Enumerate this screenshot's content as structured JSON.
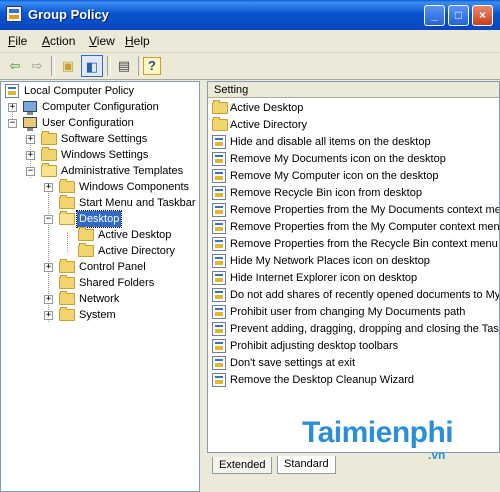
{
  "window": {
    "title": "Group Policy",
    "buttons": {
      "minimize": "_",
      "maximize": "□",
      "close": "×"
    }
  },
  "menu": [
    {
      "mnemonic": "F",
      "rest": "ile"
    },
    {
      "mnemonic": "A",
      "rest": "ction"
    },
    {
      "mnemonic": "V",
      "rest": "iew"
    },
    {
      "mnemonic": "H",
      "rest": "elp"
    }
  ],
  "toolbar": {
    "back": "⇦",
    "forward": "⇨",
    "up_folder": "▣",
    "show_hide_tree": "◧",
    "export_list": "▤",
    "help": "?"
  },
  "tree": {
    "root": "Local Computer Policy",
    "computer_configuration": "Computer Configuration",
    "user_configuration": "User Configuration",
    "software_settings": "Software Settings",
    "windows_settings": "Windows Settings",
    "administrative_templates": "Administrative Templates",
    "windows_components": "Windows Components",
    "start_menu_and_taskbar": "Start Menu and Taskbar",
    "desktop": "Desktop",
    "active_desktop": "Active Desktop",
    "active_directory": "Active Directory",
    "control_panel": "Control Panel",
    "shared_folders": "Shared Folders",
    "network": "Network",
    "system": "System",
    "expand_plus": "+",
    "collapse_minus": "−"
  },
  "list": {
    "column_header": "Setting",
    "folders": [
      "Active Desktop",
      "Active Directory"
    ],
    "policies": [
      "Hide and disable all items on the desktop",
      "Remove My Documents icon on the desktop",
      "Remove My Computer icon on the desktop",
      "Remove Recycle Bin icon from desktop",
      "Remove Properties from the My Documents context menu",
      "Remove Properties from the My Computer context menu",
      "Remove Properties from the Recycle Bin context menu",
      "Hide My Network Places icon on desktop",
      "Hide Internet Explorer icon on desktop",
      "Do not add shares of recently opened documents to My Network Places",
      "Prohibit user from changing My Documents path",
      "Prevent adding, dragging, dropping and closing the Taskbar's toolbars",
      "Prohibit adjusting desktop toolbars",
      "Don't save settings at exit",
      "Remove the Desktop Cleanup Wizard"
    ]
  },
  "tabs": [
    "Extended",
    "Standard"
  ],
  "active_tab": "Standard",
  "watermark": {
    "name": "Taimienphi",
    "domain": ".vn"
  }
}
